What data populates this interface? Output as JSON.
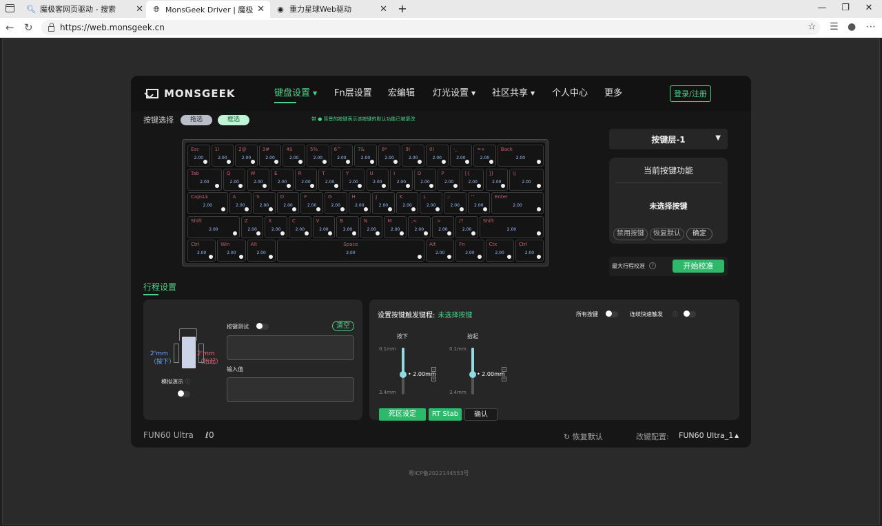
{
  "browser": {
    "tabs": [
      {
        "title": "魔极客网页驱动 - 搜索",
        "icon": "search-icon",
        "active": false
      },
      {
        "title": "MonsGeek Driver | 魔极客云驱动",
        "icon": "globe-icon",
        "active": true
      },
      {
        "title": "重力星球Web驱动",
        "icon": "planet-icon",
        "active": false
      }
    ],
    "url": "https://web.monsgeek.cn"
  },
  "nav": {
    "logo": "MONSGEEK",
    "items": [
      {
        "label": "键盘设置",
        "active": true,
        "caret": true
      },
      {
        "label": "Fn层设置",
        "active": false,
        "caret": false
      },
      {
        "label": "宏编辑",
        "active": false,
        "caret": false
      },
      {
        "label": "灯光设置",
        "active": false,
        "caret": true
      },
      {
        "label": "社区共享",
        "active": false,
        "caret": true
      },
      {
        "label": "个人中心",
        "active": false,
        "caret": false
      },
      {
        "label": "更多",
        "active": false,
        "caret": false
      }
    ],
    "login": "登录/注册"
  },
  "keyselect": {
    "label": "按键选择",
    "opt1": "拖选",
    "opt2": "框选",
    "note": "带 ● 背景的按键表示该按键的默认功能已被更改"
  },
  "keyboard": {
    "value": "2.00",
    "rows": [
      [
        "Esc",
        "1!",
        "2@",
        "3#",
        "4$",
        "5%",
        "6^",
        "7&",
        "8*",
        "9(",
        "0)",
        "-_",
        "=+",
        "Back"
      ],
      [
        "Tab",
        "Q",
        "W",
        "E",
        "R",
        "T",
        "Y",
        "U",
        "I",
        "O",
        "P",
        "[{",
        "]}",
        "\\|"
      ],
      [
        "CapsLk",
        "A",
        "S",
        "D",
        "F",
        "G",
        "H",
        "J",
        "K",
        "L",
        ";:",
        "'\"",
        "Enter"
      ],
      [
        "Shift",
        "Z",
        "X",
        "C",
        "V",
        "B",
        "N",
        "M",
        ",<",
        ".>",
        "/?",
        "Shift"
      ],
      [
        "Ctrl",
        "Win",
        "Alt",
        "Space",
        "Alt",
        "Fn",
        "Ctx",
        "Ctrl"
      ]
    ]
  },
  "right": {
    "layer": "按键层-1",
    "current_title": "当前按键功能",
    "current_msg": "未选择按键",
    "btn_disable": "禁用按键",
    "btn_restore": "恢复默认",
    "btn_ok": "确定",
    "calib_label": "最大行程校准",
    "calib_btn": "开始校准"
  },
  "travel": {
    "title": "行程设置",
    "press_val": "2'mm",
    "press_lab": "（按下）",
    "lift_val": "2'mm",
    "lift_lab": "（抬起）",
    "sim": "模拟演示",
    "key_test": "按键测试",
    "clear": "清空",
    "input_label": "输入值"
  },
  "trigger": {
    "title": "设置按键触发键程:",
    "status": "未选择按键",
    "all_keys": "所有按键",
    "continuous": "连续快速触发",
    "press": {
      "label": "按下",
      "min": "0.1mm",
      "max": "3.4mm",
      "value": "2.00mm",
      "fraction": 0.57
    },
    "lift": {
      "label": "抬起",
      "min": "0.1mm",
      "max": "3.4mm",
      "value": "2.00mm",
      "fraction": 0.57
    },
    "btn_deadzone": "死区设定",
    "btn_rt": "RT Stab",
    "btn_confirm": "确认"
  },
  "footer": {
    "model": "FUN60 Ultra",
    "restore": "恢复默认",
    "config_label": "改键配置:",
    "config_value": "FUN60 Ultra_1",
    "icp": "粤ICP备2022144553号"
  },
  "colors": {
    "accent": "#4fd18b",
    "button_green": "#2eb86a",
    "key_label": "#c0626c",
    "key_value": "#9ec6ff"
  }
}
